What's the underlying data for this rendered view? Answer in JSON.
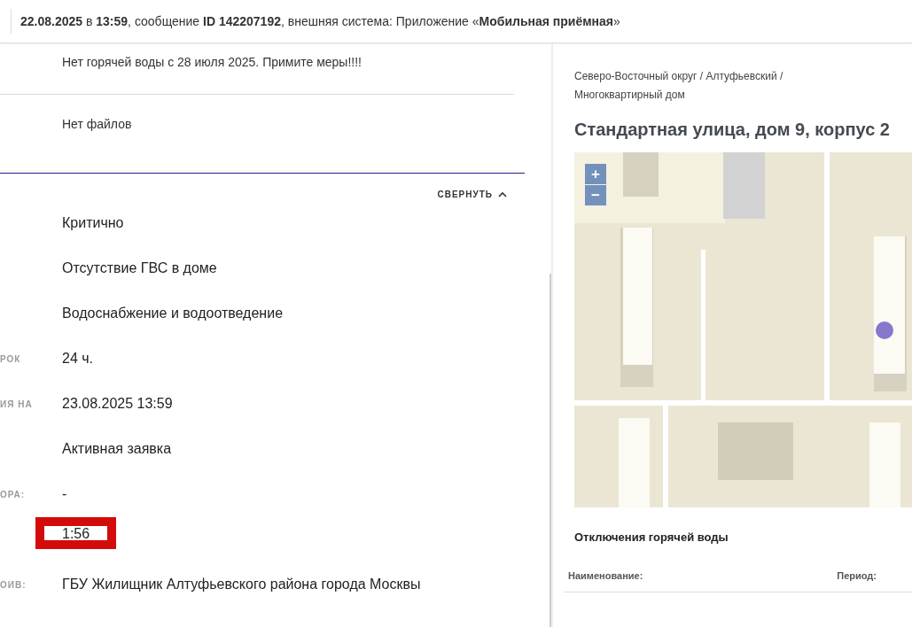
{
  "header": {
    "text": "**22.08.2025** в **13:59**, сообщение **ID 142207192**, внешняя система: Приложение «**Мобильная приёмная**»"
  },
  "message": {
    "text": "Нет горячей воды с 28 июля 2025. Примите меры!!!!"
  },
  "files": {
    "text": "Нет файлов"
  },
  "collapse_button": {
    "label": "СВЕРНУТЬ"
  },
  "fields": [
    {
      "value": "Критично",
      "highlighted": false
    },
    {
      "value": "Отсутствие ГВС в доме",
      "highlighted": false
    },
    {
      "value": "Водоснабжение и водоотведение",
      "highlighted": false
    },
    {
      "label": "РОК",
      "value": "24 ч.",
      "highlighted": false
    },
    {
      "label": "ИЯ НА",
      "value": "23.08.2025 13:59",
      "highlighted": false
    },
    {
      "value": "Активная заявка",
      "highlighted": false
    },
    {
      "label": "ОРА:",
      "value": "-",
      "highlighted": false
    },
    {
      "value": "1:56",
      "highlighted": true
    },
    {
      "label": "ОИВ:",
      "value": "ГБУ Жилищник Алтуфьевского района города Москвы",
      "highlighted": false
    }
  ],
  "address": {
    "breadcrumb": "Северо-Восточный округ / Алтуфьевский / Многоквартирный дом",
    "title": "Стандартная улица, дом 9, корпус 2"
  },
  "map": {
    "zoom_in": "+",
    "zoom_out": "−"
  },
  "outages": {
    "title": "Отключения горячей воды",
    "columns": [
      "Наименование:",
      "Период:"
    ]
  }
}
